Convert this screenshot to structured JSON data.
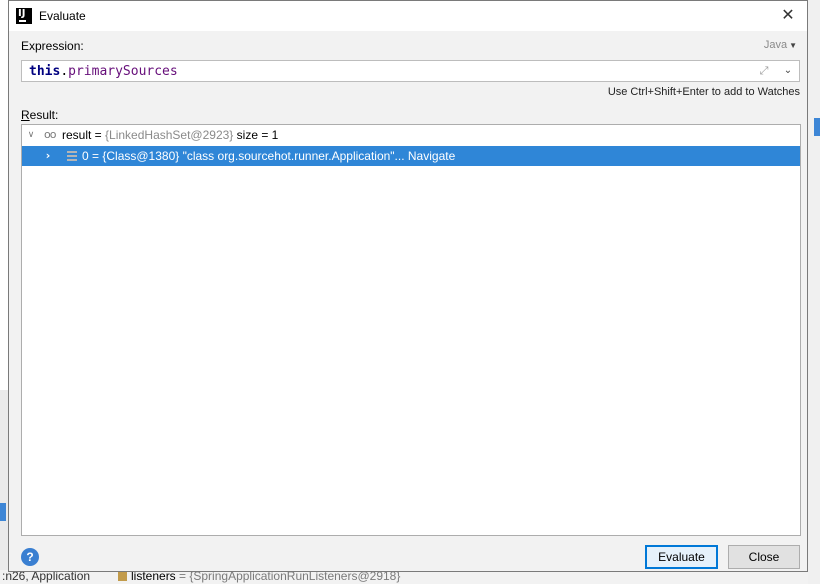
{
  "window": {
    "title": "Evaluate"
  },
  "expression": {
    "label": "Expression:",
    "language": "Java",
    "keyword": "this",
    "dot": ".",
    "field": "primarySources"
  },
  "hint": "Use Ctrl+Shift+Enter to add to Watches",
  "result": {
    "label_prefix": "R",
    "label_rest": "esult:",
    "root": {
      "name": "result",
      "eq": " = ",
      "value": "{LinkedHashSet@2923}",
      "extra": "  size = 1"
    },
    "child": {
      "text": "0 = {Class@1380} \"class org.sourcehot.runner.Application\"... Navigate"
    }
  },
  "buttons": {
    "evaluate": "Evaluate",
    "close": "Close",
    "help": "?"
  },
  "background": {
    "bottom_left": ":n26, Application",
    "bottom_brace": "{",
    "bottom_var": "listeners",
    "bottom_eq": " = ",
    "bottom_val": "{SpringApplicationRunListeners@2918}"
  }
}
